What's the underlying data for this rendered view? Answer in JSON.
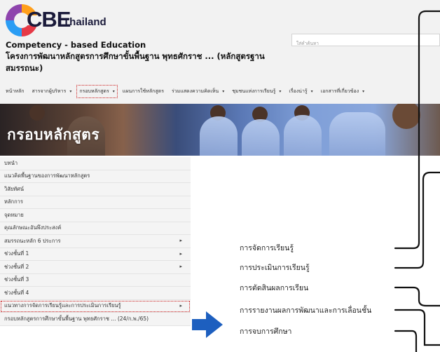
{
  "header": {
    "logo_text": "CBE",
    "logo_country": "Thailand",
    "subtitle": "Competency - based Education",
    "title": "โครงการพัฒนาหลักสูตรการศึกษาขั้นพื้นฐาน พุทธศักราช ... (หลักสูตรฐานสมรรถนะ)"
  },
  "search": {
    "placeholder": "ใส่คำค้นหา"
  },
  "nav": {
    "items": [
      {
        "label": "หน้าหลัก",
        "dropdown": false,
        "active": false
      },
      {
        "label": "สารจากผู้บริหาร",
        "dropdown": true,
        "active": false
      },
      {
        "label": "กรอบหลักสูตร",
        "dropdown": true,
        "active": true
      },
      {
        "label": "แผนการใช้หลักสูตร",
        "dropdown": false,
        "active": false
      },
      {
        "label": "ร่วมแสดงความคิดเห็น",
        "dropdown": true,
        "active": false
      },
      {
        "label": "ชุมชนแห่งการเรียนรู้",
        "dropdown": true,
        "active": false
      },
      {
        "label": "เรื่องน่ารู้",
        "dropdown": true,
        "active": false
      },
      {
        "label": "เอกสารที่เกี่ยวข้อง",
        "dropdown": true,
        "active": false
      }
    ],
    "caret_icon": "chevron-down-icon"
  },
  "banner": {
    "title": "กรอบหลักสูตร"
  },
  "sidebar": {
    "items": [
      {
        "label": "บทนำ",
        "chevron": false
      },
      {
        "label": "แนวคิดพื้นฐานของการพัฒนาหลักสูตร",
        "chevron": false
      },
      {
        "label": "วิสัยทัศน์",
        "chevron": false
      },
      {
        "label": "หลักการ",
        "chevron": false
      },
      {
        "label": "จุดหมาย",
        "chevron": false
      },
      {
        "label": "คุณลักษณะอันพึงประสงค์",
        "chevron": false
      },
      {
        "label": "สมรรถนะหลัก 6 ประการ",
        "chevron": true
      },
      {
        "label": "ช่วงชั้นที่ 1",
        "chevron": true
      },
      {
        "label": "ช่วงชั้นที่ 2",
        "chevron": true
      },
      {
        "label": "ช่วงชั้นที่ 3",
        "chevron": false
      },
      {
        "label": "ช่วงชั้นที่ 4",
        "chevron": false
      },
      {
        "label": "แนวทางการจัดการเรียนรู้และการประเมินการเรียนรู้",
        "chevron": true,
        "highlight": true
      },
      {
        "label": "กรอบหลักสูตรการศึกษาขั้นพื้นฐาน พุทธศักราช ... (24/ก.พ./65)",
        "chevron": false
      }
    ]
  },
  "submenu": {
    "items": [
      "การจัดการเรียนรู้",
      "การประเมินการเรียนรู้",
      "การตัดสินผลการเรียน",
      "การรายงานผลการพัฒนาและการเลื่อนชั้น",
      "การจบการศึกษา"
    ]
  },
  "colors": {
    "header_bg": "#f2f2f2",
    "sidebar_bg": "#f4f4f4",
    "highlight_border": "#cc1f1f",
    "arrow": "#1d5fbf",
    "bracket": "#111111",
    "banner_text": "#ffffff"
  }
}
